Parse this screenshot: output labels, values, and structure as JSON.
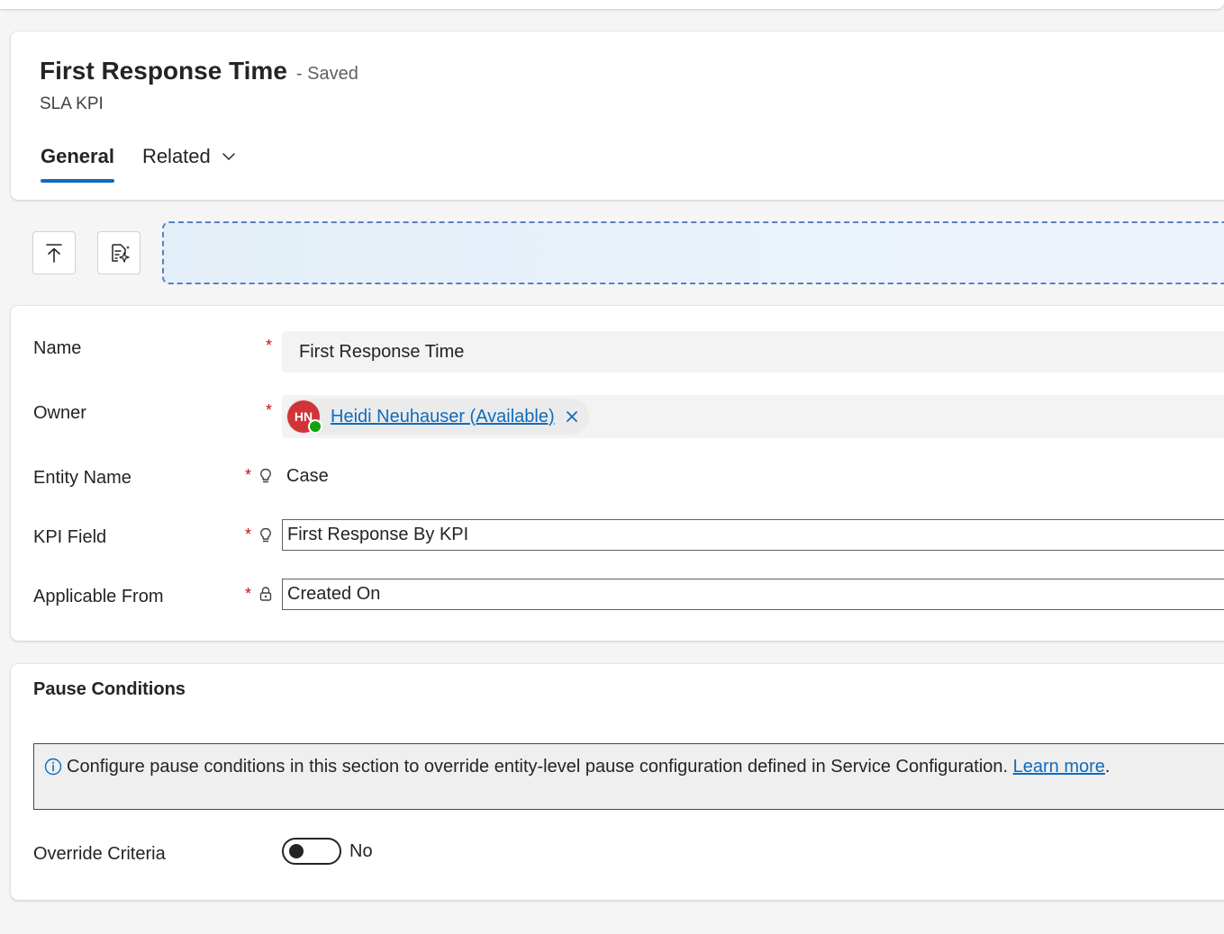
{
  "header": {
    "title": "First Response Time",
    "save_status": "- Saved",
    "entity_type": "SLA KPI",
    "tabs": [
      {
        "label": "General",
        "selected": true
      },
      {
        "label": "Related",
        "selected": false
      }
    ]
  },
  "toolbar": {
    "icons": [
      "arrow-up-to-top-icon",
      "document-sparkle-icon"
    ]
  },
  "form": {
    "fields": {
      "name": {
        "label": "Name",
        "required": "*",
        "value": "First Response Time"
      },
      "owner": {
        "label": "Owner",
        "required": "*",
        "initials": "HN",
        "value": "Heidi Neuhauser (Available)",
        "presence": "available"
      },
      "entity_name": {
        "label": "Entity Name",
        "required": "*",
        "value": "Case",
        "icon": "lightbulb-icon"
      },
      "kpi_field": {
        "label": "KPI Field",
        "required": "*",
        "value": "First Response By KPI",
        "icon": "lightbulb-icon"
      },
      "applicable_from": {
        "label": "Applicable From",
        "required": "*",
        "value": "Created On",
        "icon": "lock-icon"
      }
    }
  },
  "pause": {
    "title": "Pause Conditions",
    "info_text": "Configure pause conditions in this section to override entity-level pause configuration defined in Service Configuration.",
    "learn_more": "Learn more",
    "info_tail": ".",
    "override_label": "Override Criteria",
    "override_value": "No",
    "override_on": false
  },
  "colors": {
    "accent": "#0f6cbd",
    "required": "#c50f1f",
    "avatar": "#d13438",
    "presence_available": "#13a10e"
  }
}
